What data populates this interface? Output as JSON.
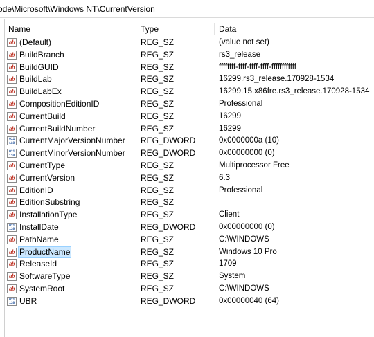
{
  "address": {
    "path": "ode\\Microsoft\\Windows NT\\CurrentVersion"
  },
  "columns": {
    "name": "Name",
    "type": "Type",
    "data": "Data"
  },
  "rows": [
    {
      "name": "(Default)",
      "type": "REG_SZ",
      "data": "(value not set)",
      "icon": "string-value-icon"
    },
    {
      "name": "BuildBranch",
      "type": "REG_SZ",
      "data": "rs3_release",
      "icon": "string-value-icon"
    },
    {
      "name": "BuildGUID",
      "type": "REG_SZ",
      "data": "ffffffff-ffff-ffff-ffff-ffffffffffff",
      "icon": "string-value-icon"
    },
    {
      "name": "BuildLab",
      "type": "REG_SZ",
      "data": "16299.rs3_release.170928-1534",
      "icon": "string-value-icon"
    },
    {
      "name": "BuildLabEx",
      "type": "REG_SZ",
      "data": "16299.15.x86fre.rs3_release.170928-1534",
      "icon": "string-value-icon"
    },
    {
      "name": "CompositionEditionID",
      "type": "REG_SZ",
      "data": "Professional",
      "icon": "string-value-icon"
    },
    {
      "name": "CurrentBuild",
      "type": "REG_SZ",
      "data": "16299",
      "icon": "string-value-icon"
    },
    {
      "name": "CurrentBuildNumber",
      "type": "REG_SZ",
      "data": "16299",
      "icon": "string-value-icon"
    },
    {
      "name": "CurrentMajorVersionNumber",
      "type": "REG_DWORD",
      "data": "0x0000000a (10)",
      "icon": "binary-value-icon"
    },
    {
      "name": "CurrentMinorVersionNumber",
      "type": "REG_DWORD",
      "data": "0x00000000 (0)",
      "icon": "binary-value-icon"
    },
    {
      "name": "CurrentType",
      "type": "REG_SZ",
      "data": "Multiprocessor Free",
      "icon": "string-value-icon"
    },
    {
      "name": "CurrentVersion",
      "type": "REG_SZ",
      "data": "6.3",
      "icon": "string-value-icon"
    },
    {
      "name": "EditionID",
      "type": "REG_SZ",
      "data": "Professional",
      "icon": "string-value-icon"
    },
    {
      "name": "EditionSubstring",
      "type": "REG_SZ",
      "data": "",
      "icon": "string-value-icon"
    },
    {
      "name": "InstallationType",
      "type": "REG_SZ",
      "data": "Client",
      "icon": "string-value-icon"
    },
    {
      "name": "InstallDate",
      "type": "REG_DWORD",
      "data": "0x00000000 (0)",
      "icon": "binary-value-icon"
    },
    {
      "name": "PathName",
      "type": "REG_SZ",
      "data": "C:\\WINDOWS",
      "icon": "string-value-icon"
    },
    {
      "name": "ProductName",
      "type": "REG_SZ",
      "data": "Windows 10 Pro",
      "icon": "string-value-icon",
      "selected": true
    },
    {
      "name": "ReleaseId",
      "type": "REG_SZ",
      "data": "1709",
      "icon": "string-value-icon"
    },
    {
      "name": "SoftwareType",
      "type": "REG_SZ",
      "data": "System",
      "icon": "string-value-icon"
    },
    {
      "name": "SystemRoot",
      "type": "REG_SZ",
      "data": "C:\\WINDOWS",
      "icon": "string-value-icon"
    },
    {
      "name": "UBR",
      "type": "REG_DWORD",
      "data": "0x00000040 (64)",
      "icon": "binary-value-icon"
    }
  ],
  "colors": {
    "selection_background": "#cce8ff",
    "selection_border": "#99d1ff",
    "string_icon": "#c0392b",
    "dword_icon": "#2c5aa0"
  }
}
